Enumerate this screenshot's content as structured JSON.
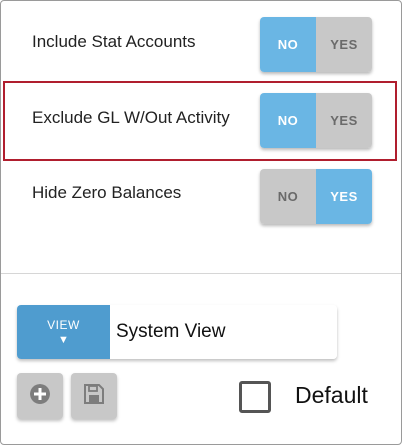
{
  "options": [
    {
      "label": "Include Stat Accounts",
      "no": "NO",
      "yes": "YES",
      "selected": "NO"
    },
    {
      "label": "Exclude GL W/Out Activity",
      "no": "NO",
      "yes": "YES",
      "selected": "NO"
    },
    {
      "label": "Hide Zero Balances",
      "no": "NO",
      "yes": "YES",
      "selected": "YES"
    }
  ],
  "view": {
    "button_label": "VIEW",
    "caret": "▼",
    "current": "System View"
  },
  "actions": {
    "add_icon": "plus-circle-icon",
    "save_icon": "floppy-disk-icon"
  },
  "default_checkbox": {
    "label": "Default",
    "checked": false
  },
  "colors": {
    "toggle_active": "#6ab6e4",
    "toggle_inactive": "#c8c8c8",
    "view_button": "#4f9ccf",
    "highlight": "#b01e2e"
  }
}
